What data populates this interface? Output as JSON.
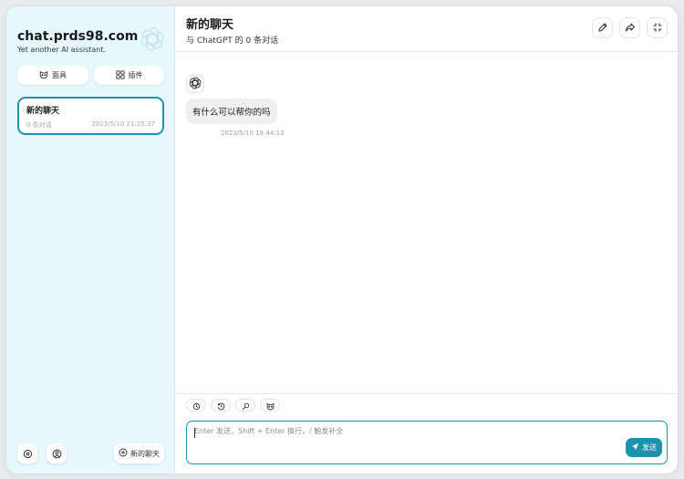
{
  "sidebar": {
    "title": "chat.prds98.com",
    "subtitle": "Yet another AI assistant.",
    "logo_icon": "openai-logo-icon",
    "buttons": [
      {
        "label": "面具",
        "icon": "mask-icon"
      },
      {
        "label": "插件",
        "icon": "plugin-grid-icon"
      }
    ],
    "chats": [
      {
        "title": "新的聊天",
        "count": "0 条对话",
        "time": "2023/5/10 21:25:37",
        "selected": true
      }
    ],
    "footer": {
      "settings_icon": "settings-icon",
      "github_icon": "github-icon",
      "new_chat_label": "新的聊天"
    }
  },
  "main": {
    "title": "新的聊天",
    "subtitle": "与 ChatGPT 的 0 条对话",
    "header_buttons": [
      "edit-icon",
      "share-icon",
      "fullscreen-icon"
    ],
    "messages": [
      {
        "role": "assistant",
        "text": "有什么可以帮你的吗",
        "time": "2023/5/10 18:44:13"
      }
    ]
  },
  "composer": {
    "actions": [
      "settings-icon",
      "history-icon",
      "prompt-icon",
      "mask-icon"
    ],
    "placeholder": "Enter 发送，Shift + Enter 换行，/ 触发补全",
    "send_label": "发送"
  },
  "colors": {
    "accent": "#1d93ab",
    "sidebar_bg": "#e7f8ff",
    "bubble_bg": "#f0f0f0"
  }
}
